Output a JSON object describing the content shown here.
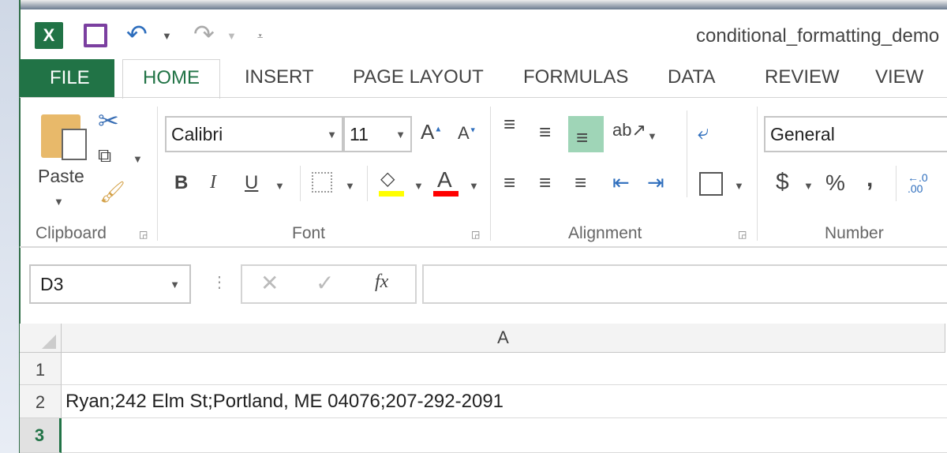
{
  "window": {
    "title": "conditional_formatting_demo"
  },
  "tabs": [
    {
      "label": "FILE"
    },
    {
      "label": "HOME"
    },
    {
      "label": "INSERT"
    },
    {
      "label": "PAGE LAYOUT"
    },
    {
      "label": "FORMULAS"
    },
    {
      "label": "DATA"
    },
    {
      "label": "REVIEW"
    },
    {
      "label": "VIEW"
    }
  ],
  "ribbon": {
    "clipboard": {
      "label": "Clipboard",
      "paste": "Paste"
    },
    "font": {
      "label": "Font",
      "name": "Calibri",
      "size": "11",
      "bold": "B",
      "italic": "I",
      "underline": "U"
    },
    "alignment": {
      "label": "Alignment"
    },
    "number": {
      "label": "Number",
      "format": "General",
      "currency": "$",
      "percent": "%",
      "comma": ","
    }
  },
  "formula_bar": {
    "name_box": "D3",
    "fx": "fx",
    "value": ""
  },
  "sheet": {
    "columns": [
      "A"
    ],
    "rows": [
      {
        "num": "1",
        "A": ""
      },
      {
        "num": "2",
        "A": "Ryan;242 Elm St;Portland, ME 04076;207-292-2091"
      },
      {
        "num": "3",
        "A": ""
      }
    ],
    "active_row": "3"
  },
  "colors": {
    "excel_green": "#217346",
    "selected_align": "#9fd5b7",
    "highlight_yellow": "#ffff00",
    "font_red": "#ff0000"
  }
}
